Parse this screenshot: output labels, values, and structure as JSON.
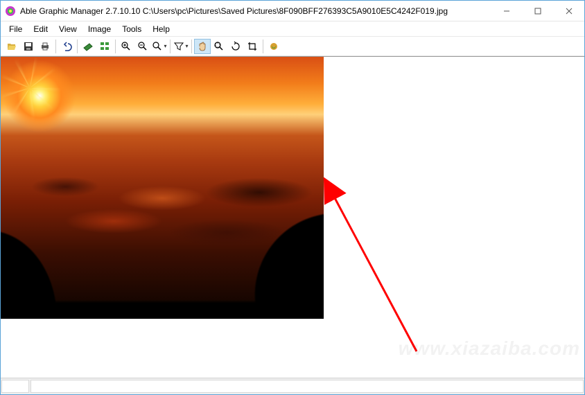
{
  "window": {
    "title": "Able Graphic Manager 2.7.10.10 C:\\Users\\pc\\Pictures\\Saved Pictures\\8F090BFF276393C5A9010E5C4242F019.jpg"
  },
  "menu": {
    "items": [
      "File",
      "Edit",
      "View",
      "Image",
      "Tools",
      "Help"
    ]
  },
  "toolbar": {
    "groups": [
      [
        "open-icon",
        "save-icon",
        "print-icon"
      ],
      [
        "undo-icon"
      ],
      [
        "scanner-icon",
        "folder-tree-icon"
      ],
      [
        "zoom-in-icon",
        "zoom-out-icon",
        "zoom-fit-icon"
      ],
      [
        "filter-icon"
      ],
      [
        "hand-pan-icon",
        "zoom-lasso-icon",
        "rotate-icon",
        "crop-icon"
      ],
      [
        "batch-process-icon"
      ]
    ],
    "active": "hand-pan-icon"
  },
  "watermark": "www.xiazaiba.com"
}
